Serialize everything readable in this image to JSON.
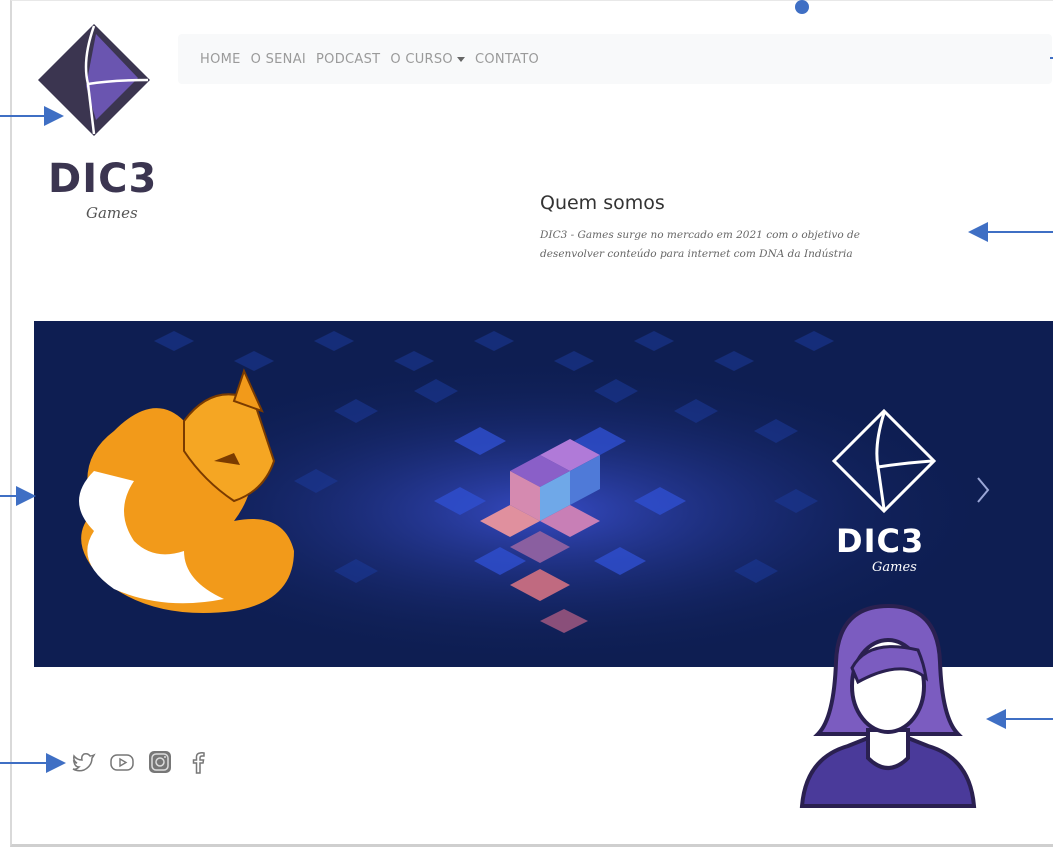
{
  "brand": {
    "title": "DIC3",
    "subtitle": "Games"
  },
  "nav": {
    "items": [
      {
        "label": "HOME"
      },
      {
        "label": "O SENAI"
      },
      {
        "label": "PODCAST"
      },
      {
        "label": "O CURSO"
      },
      {
        "label": "CONTATO"
      }
    ]
  },
  "about": {
    "title": "Quem somos",
    "text_line1": "DIC3 - Games surge no mercado em 2021 com o objetivo de",
    "text_line2": "desenvolver conteúdo para internet com DNA da Indústria"
  },
  "banner": {
    "logo_title": "DIC3",
    "logo_subtitle": "Games"
  },
  "social": [
    "twitter-icon",
    "youtube-icon",
    "instagram-icon",
    "facebook-icon"
  ],
  "colors": {
    "brand_dark": "#3b3550",
    "brand_purple": "#6a55b0",
    "banner_bg": "#0e1e52",
    "annotation": "#3f6fc4",
    "avatar_purple": "#7b5cc0"
  }
}
